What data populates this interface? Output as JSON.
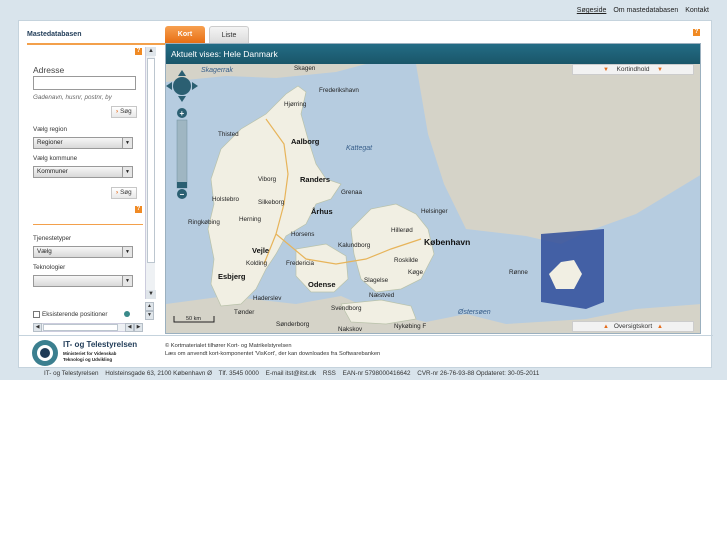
{
  "top_links": [
    "Søgeside",
    "Om mastedatabasen",
    "Kontakt"
  ],
  "sidebar": {
    "title": "Mastedatabasen",
    "help": "?",
    "address_label": "Adresse",
    "address_value": "",
    "address_hint": "Gadenavn, husnr, postnr, by",
    "search_label": "Søg",
    "region_label": "Vælg region",
    "region_value": "Regioner",
    "kommune_label": "Vælg kommune",
    "kommune_value": "Kommuner",
    "search2_label": "Søg",
    "tjeneste_label": "Tjenestetyper",
    "tjeneste_value": "Vælg",
    "teknologier_label": "Teknologier",
    "teknologier_value": "",
    "existing_label": "Eksisterende positioner"
  },
  "tabs": [
    {
      "label": "Kort",
      "active": true
    },
    {
      "label": "Liste",
      "active": false
    }
  ],
  "map": {
    "header": "Aktuelt vises: Hele Danmark",
    "kortindhold": "Kortindhold",
    "oversigtskort": "Oversigtskort",
    "scale": "50 km",
    "places": {
      "skagerrak": "Skagerrak",
      "skagen": "Skagen",
      "frederikshavn": "Frederikshavn",
      "hjorring": "Hjørring",
      "thisted": "Thisted",
      "aalborg": "Aalborg",
      "kattegat": "Kattegat",
      "viborg": "Viborg",
      "randers": "Randers",
      "grenaa": "Grenaa",
      "holstebro": "Holstebro",
      "silkeborg": "Silkeborg",
      "aarhus": "Århus",
      "ringkobing": "Ringkøbing",
      "herning": "Herning",
      "helsinger": "Helsinger",
      "hillerod": "Hillerød",
      "kobenhavn": "København",
      "horsens": "Horsens",
      "kalundborg": "Kalundborg",
      "vejle": "Vejle",
      "kolding": "Kolding",
      "fredericia": "Fredericia",
      "roskilde": "Roskilde",
      "koge": "Køge",
      "esbjerg": "Esbjerg",
      "slagelse": "Slagelse",
      "odense": "Odense",
      "naestved": "Næstved",
      "haderslev": "Haderslev",
      "svendborg": "Svendborg",
      "tonder": "Tønder",
      "sonderborg": "Sønderborg",
      "nakskov": "Nakskov",
      "nykobing": "Nykøbing F",
      "ronne": "Rønne",
      "ostersoen": "Østersøen"
    }
  },
  "footer": {
    "logo_title": "IT- og Telestyrelsen",
    "logo_sub1": "Ministeriet for Videnskab",
    "logo_sub2": "Teknologi og Udvikling",
    "line1": "© Kortmaterialet tilhører Kort- og Matrikelstyrelsen",
    "line2": "Læs om anvendt kort-komponentet 'VisKort', der kan downloades fra Softwarebanken",
    "address_items": [
      "IT- og Telestyrelsen",
      "Holsteinsgade 63, 2100 København Ø",
      "Tlf. 3545 0000",
      "E-mail itst@itst.dk",
      "RSS",
      "EAN-nr 5798000416642",
      "CVR-nr 26-76-93-88 Opdateret: 30-05-2011"
    ]
  },
  "colors": {
    "accent": "#e8731a",
    "map_header": "#1a5669",
    "sea": "#b6cce0",
    "land": "#f1efe3"
  }
}
